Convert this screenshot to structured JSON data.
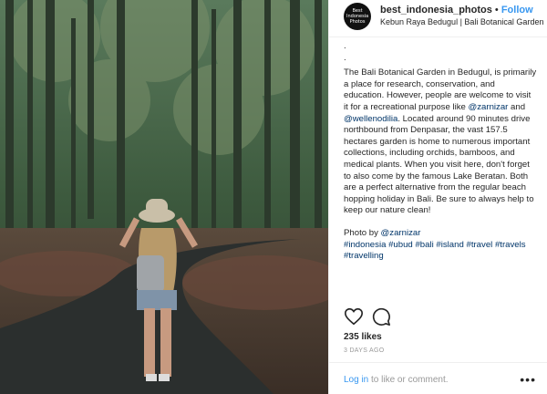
{
  "post": {
    "username": "best_indonesia_photos",
    "follow_separator": " • ",
    "follow_label": "Follow",
    "location": "Kebun Raya Bedugul | Bali Botanical Garden",
    "avatar_text": "Best Indonesia Photos"
  },
  "caption": {
    "dots": ".",
    "dots2": ".",
    "p1_a": "The Bali Botanical Garden in Bedugul, is primarily a place for research, conservation, and education. However, people are welcome to visit it for a recreational purpose like ",
    "mention1": "@zarnizar",
    "and": " and ",
    "mention2": "@wellenodilia",
    "p1_b": ". Located around 90 minutes drive northbound from Denpasar, the vast 157.5 hectares garden is home to numerous important collections, including orchids, bamboos, and medical plants. When you visit here, don't forget to also come by the famous Lake Beratan. Both are a perfect alternative from the regular beach hopping holiday in Bali. Be sure to always help to keep our nature clean!",
    "photo_by": "Photo by ",
    "photo_mention": "@zarnizar",
    "hashtags": [
      "#indonesia",
      "#ubud",
      "#bali",
      "#island",
      "#travel",
      "#travels",
      "#travelling"
    ]
  },
  "likes": "235 likes",
  "time": "3 DAYS AGO",
  "comment": {
    "login": "Log in",
    "rest": " to like or comment."
  },
  "more_label": "•••",
  "colors": {
    "link": "#003569",
    "accent": "#3897f0",
    "text": "#262626",
    "muted": "#999999"
  },
  "icons": [
    "heart-icon",
    "comment-icon",
    "more-icon"
  ]
}
